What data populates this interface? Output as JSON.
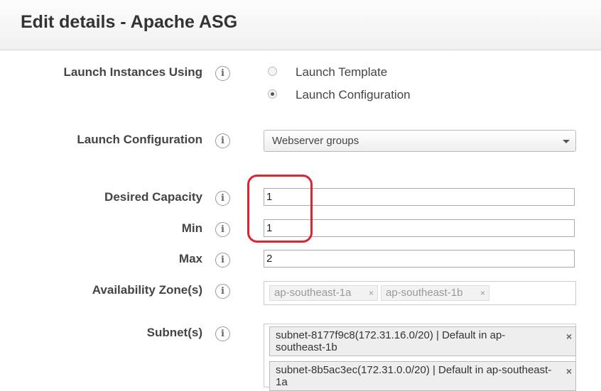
{
  "header": {
    "title": "Edit details - Apache ASG"
  },
  "launch_instances": {
    "label": "Launch Instances Using",
    "options": [
      {
        "label": "Launch Template",
        "checked": false
      },
      {
        "label": "Launch Configuration",
        "checked": true
      }
    ]
  },
  "launch_configuration": {
    "label": "Launch Configuration",
    "value": "Webserver groups"
  },
  "desired_capacity": {
    "label": "Desired Capacity",
    "value": "1"
  },
  "min": {
    "label": "Min",
    "value": "1"
  },
  "max": {
    "label": "Max",
    "value": "2"
  },
  "availability_zones": {
    "label": "Availability Zone(s)",
    "tags": [
      "ap-southeast-1a",
      "ap-southeast-1b"
    ]
  },
  "subnets": {
    "label": "Subnet(s)",
    "tags": [
      "subnet-8177f9c8(172.31.16.0/20) | Default in ap-southeast-1b",
      "subnet-8b5ac3ec(172.31.0.0/20) | Default in ap-southeast-1a"
    ]
  },
  "icons": {
    "info": "i",
    "remove": "×"
  },
  "colors": {
    "highlight": "#e0232f"
  }
}
